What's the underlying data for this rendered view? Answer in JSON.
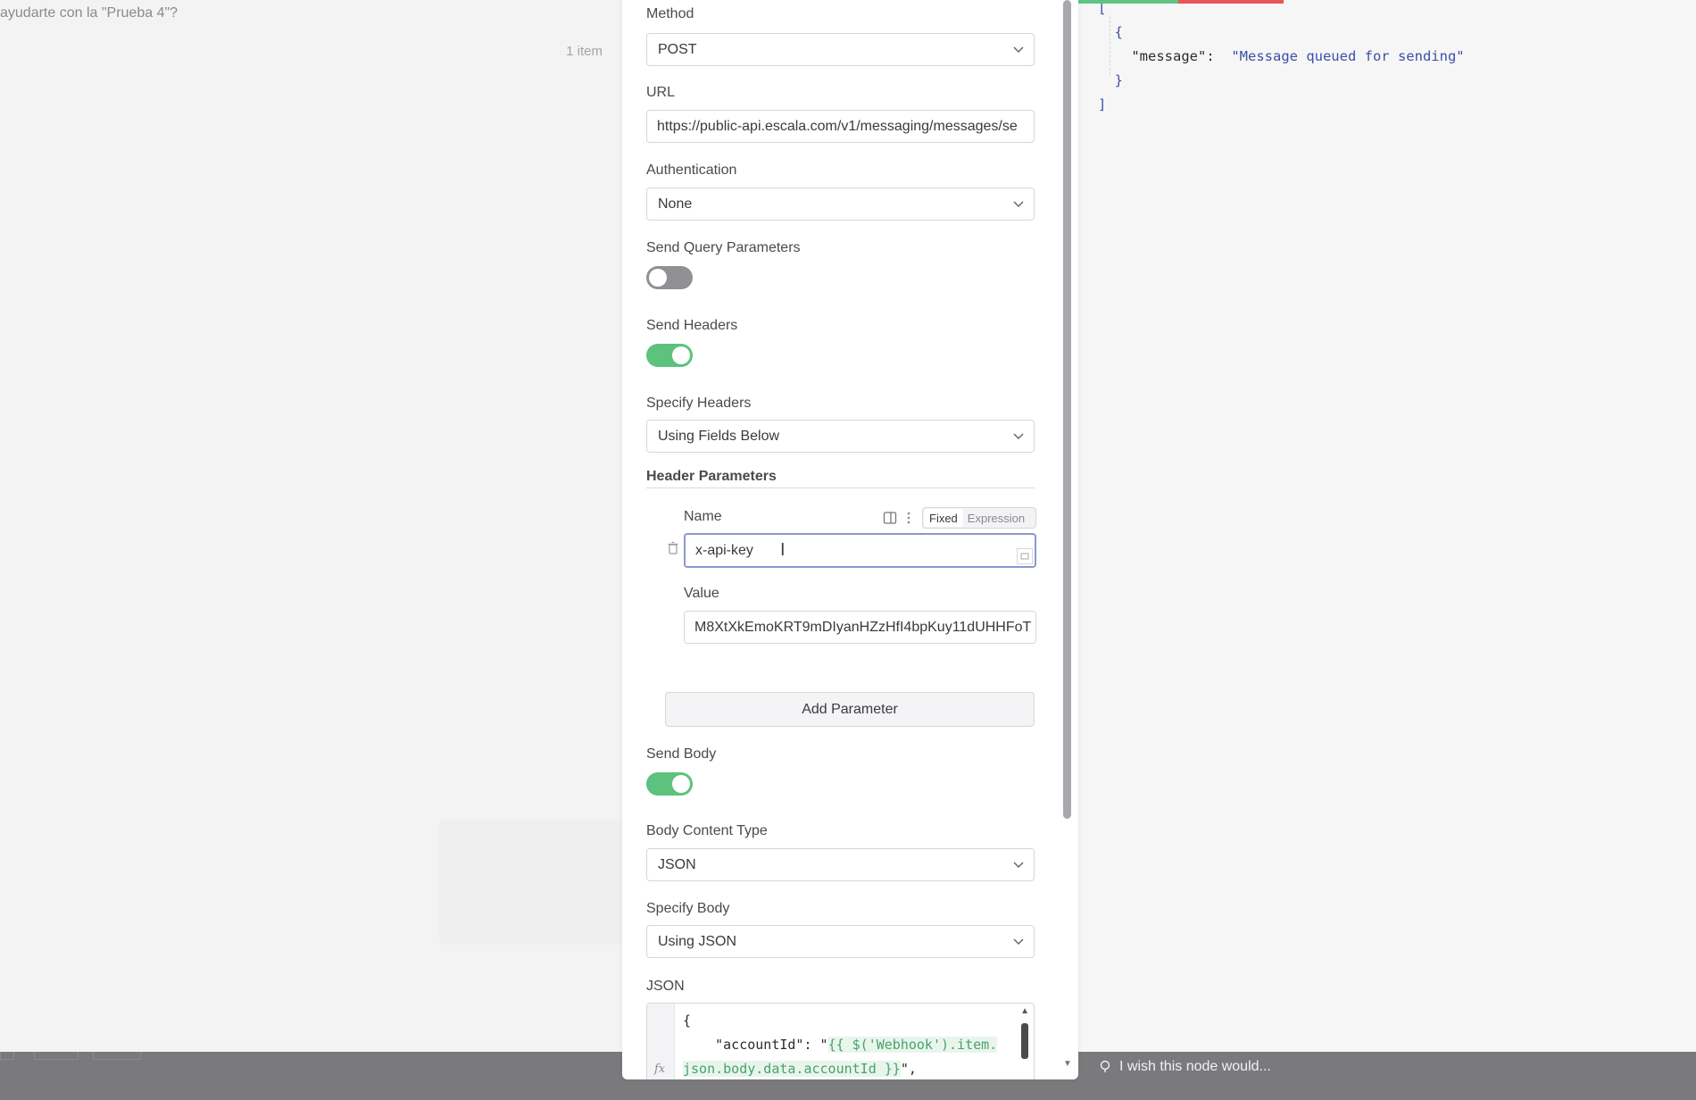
{
  "left_pane": {
    "prompt_fragment": "ayudarte con la \"Prueba 4\"?",
    "item_count": "1 item"
  },
  "output": {
    "line1": "[",
    "line2": "{",
    "key": "\"message\":",
    "value": "\"Message queued for sending\"",
    "line4": "}",
    "line5": "]"
  },
  "params": {
    "method": {
      "label": "Method",
      "value": "POST"
    },
    "url": {
      "label": "URL",
      "value": "https://public-api.escala.com/v1/messaging/messages/se"
    },
    "authentication": {
      "label": "Authentication",
      "value": "None"
    },
    "send_query": {
      "label": "Send Query Parameters",
      "enabled": false
    },
    "send_headers": {
      "label": "Send Headers",
      "enabled": true
    },
    "specify_headers": {
      "label": "Specify Headers",
      "value": "Using Fields Below"
    },
    "header_parameters": {
      "title": "Header Parameters",
      "name_label": "Name",
      "name_value": "x-api-key",
      "mode_fixed": "Fixed",
      "mode_expression": "Expression",
      "value_label": "Value",
      "value_value": "M8XtXkEmoKRT9mDIyanHZzHfI4bpKuy11dUHHFoT"
    },
    "add_parameter": "Add Parameter",
    "send_body": {
      "label": "Send Body",
      "enabled": true
    },
    "body_content_type": {
      "label": "Body Content Type",
      "value": "JSON"
    },
    "specify_body": {
      "label": "Specify Body",
      "value": "Using JSON"
    },
    "json": {
      "label": "JSON",
      "line1": "{",
      "line2_key": "    \"accountId\": \"",
      "line2_expr": "{{ $('Webhook').item.",
      "line3_expr": "json.body.data.accountId }}",
      "line3_tail": "\","
    }
  },
  "bottom_bar": {
    "feedback": "I wish this node would..."
  },
  "colors": {
    "toggle_on": "#5cc27e",
    "toggle_off": "#909095",
    "accent_red": "#e85555",
    "accent_green": "#60c482"
  }
}
